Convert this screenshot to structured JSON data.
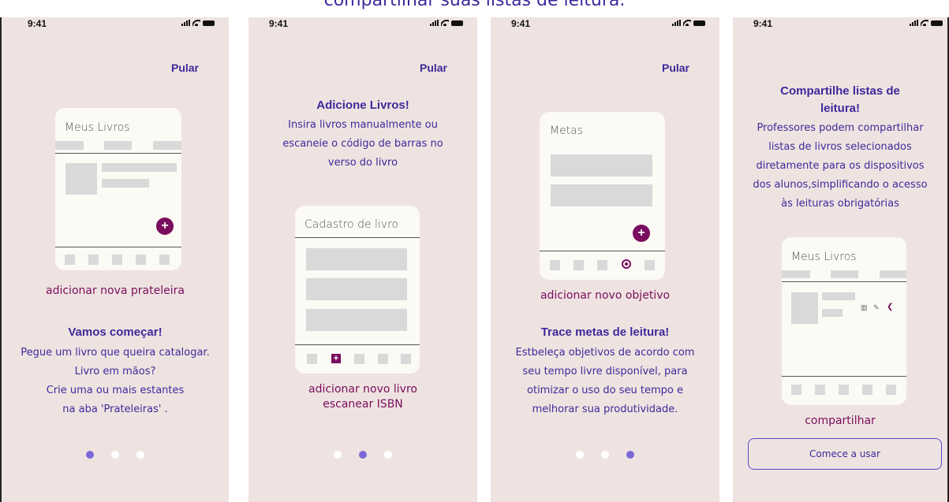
{
  "top_caption": "compartilhar suas listas de leitura.",
  "status": {
    "time": "9:41"
  },
  "skip_label": "Pular",
  "colors": {
    "background": "#efe3e1",
    "accent": "#3d2a9b",
    "magenta": "#7a0d5e",
    "dot_active": "#7b68d8"
  },
  "screens": [
    {
      "card_title": "Meus Livros",
      "caption": "adicionar nova prateleira",
      "heading": "Vamos começar!",
      "body_lines": [
        "Pegue um livro que queira catalogar.",
        "Livro em mãos?",
        "Crie uma ou mais estantes",
        "na aba 'Prateleiras' ."
      ],
      "active_dot": 0
    },
    {
      "heading": "Adicione Livros!",
      "body_lines": [
        "Insira livros manualmente ou",
        "escaneie o código de barras no",
        "verso do livro"
      ],
      "card_title": "Cadastro de livro",
      "caption_lines": [
        "adicionar novo livro",
        "escanear ISBN"
      ],
      "active_dot": 1
    },
    {
      "card_title": "Metas",
      "caption": "adicionar novo objetivo",
      "heading": "Trace metas de leitura!",
      "body_lines": [
        "Estbeleça objetivos de acordo com",
        "seu tempo livre disponível, para",
        "otimizar o uso do seu tempo e",
        "melhorar sua produtividade."
      ],
      "active_dot": 2
    },
    {
      "heading_lines": [
        "Compartilhe listas de",
        "leitura!"
      ],
      "body_lines": [
        "Professores podem compartilhar",
        "listas de livros selecionados",
        "diretamente para os dispositivos",
        "dos alunos,simplificando o acesso",
        "às leituras obrigatórias"
      ],
      "card_title": "Meus Livros",
      "caption": "compartilhar",
      "button_label": "Comece a usar"
    }
  ]
}
